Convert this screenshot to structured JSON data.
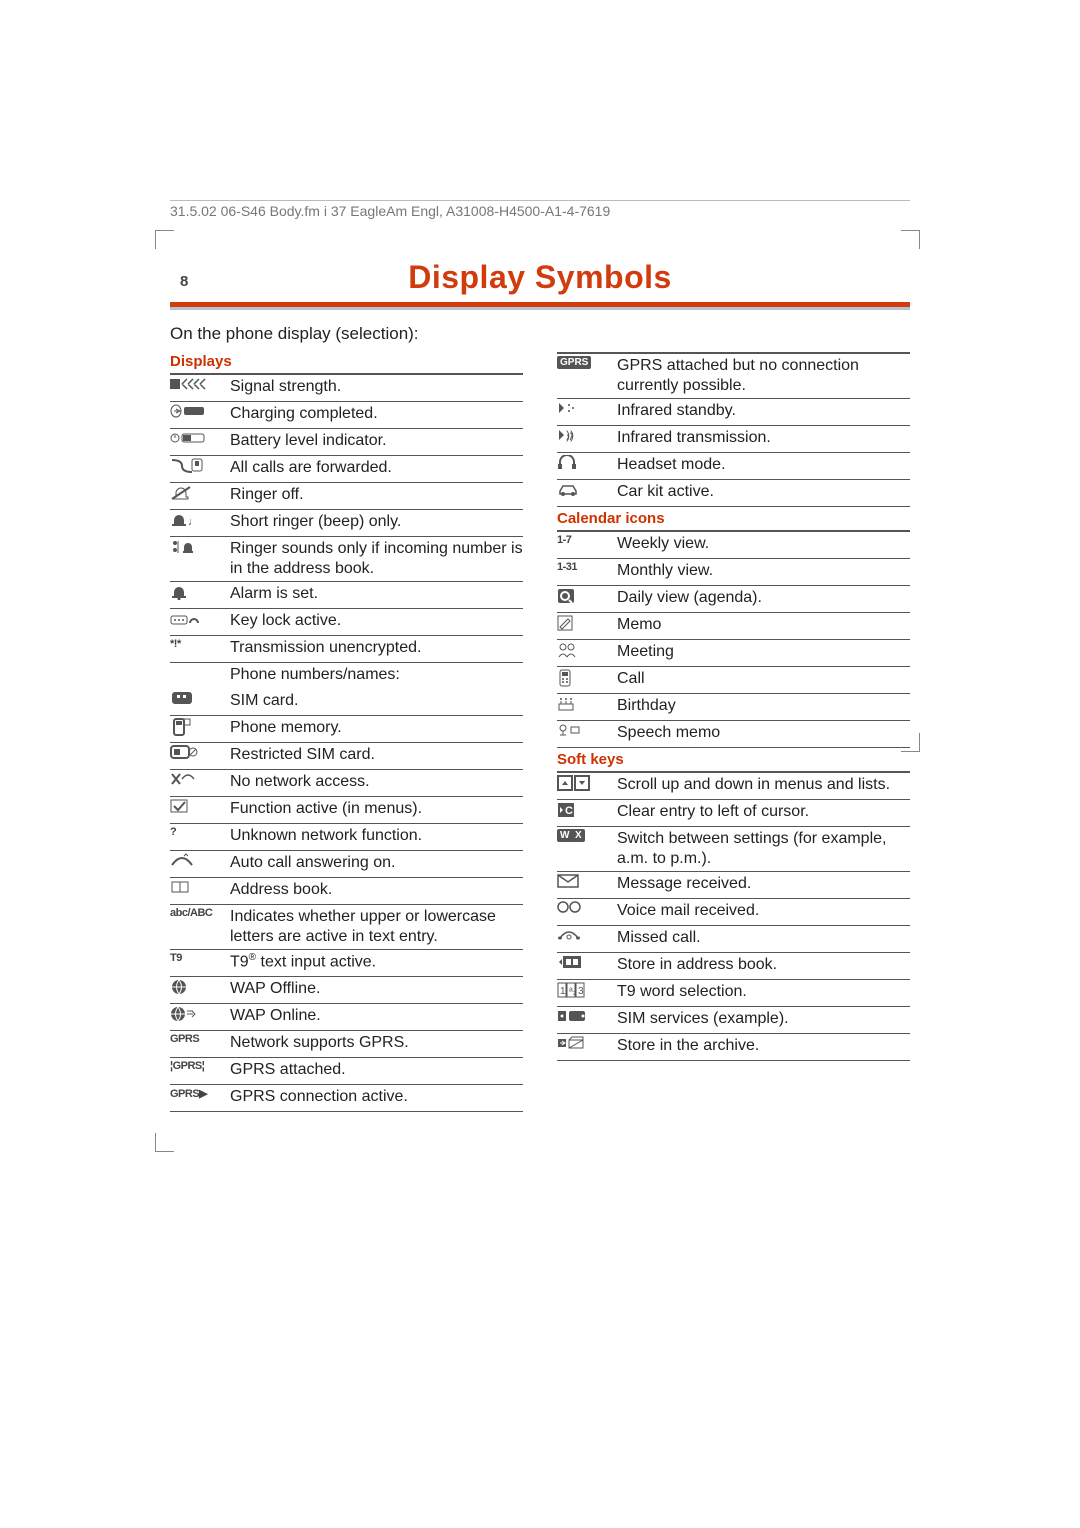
{
  "header": "31.5.02   06-S46 Body.fm   i 37 EagleAm Engl, A31008-H4500-A1-4-7619",
  "page_number": "8",
  "title": "Display Symbols",
  "intro": "On the phone display (selection):",
  "sections": {
    "displays": {
      "heading": "Displays",
      "rows": [
        {
          "icon": "signal",
          "text": "Signal strength."
        },
        {
          "icon": "charge-done",
          "text": "Charging completed."
        },
        {
          "icon": "battery",
          "text": "Battery level indicator."
        },
        {
          "icon": "forward",
          "text": "All calls are forwarded."
        },
        {
          "icon": "ringer-off",
          "text": "Ringer off."
        },
        {
          "icon": "beep",
          "text": "Short ringer (beep) only."
        },
        {
          "icon": "addr-ring",
          "text": "Ringer sounds only if incoming number is in the address book."
        },
        {
          "icon": "alarm",
          "text": "Alarm is set."
        },
        {
          "icon": "keylock",
          "text": "Key lock active."
        },
        {
          "icon": "unenc",
          "label": "*!*",
          "text": "Transmission unencrypted."
        },
        {
          "icon": "",
          "text": "Phone numbers/names:",
          "noborder": true
        },
        {
          "icon": "sim",
          "text": "SIM card."
        },
        {
          "icon": "phone-mem",
          "text": "Phone memory."
        },
        {
          "icon": "sim-restr",
          "text": "Restricted SIM card."
        },
        {
          "icon": "no-net",
          "text": "No network access."
        },
        {
          "icon": "func-active",
          "text": "Function active (in menus)."
        },
        {
          "icon": "question",
          "label": "?",
          "text": "Unknown network function."
        },
        {
          "icon": "auto-ans",
          "text": "Auto call answering on."
        },
        {
          "icon": "book",
          "text": "Address book."
        },
        {
          "icon": "abc",
          "label": "abc/ABC",
          "text": "Indicates whether upper or lowercase letters are active in text entry."
        },
        {
          "icon": "t9",
          "label": "T9",
          "text_html": "T9<span class='sup'>®</span> text input active."
        },
        {
          "icon": "wap-off",
          "text": "WAP Offline."
        },
        {
          "icon": "wap-on",
          "text": "WAP Online."
        },
        {
          "icon": "gprs",
          "label": "GPRS",
          "text": "Network supports GPRS."
        },
        {
          "icon": "gprs-att",
          "label": "¦GPRS¦",
          "text": "GPRS attached."
        },
        {
          "icon": "gprs-act",
          "label": "GPRS▶",
          "text": "GPRS connection active."
        }
      ]
    },
    "right_top": {
      "rows": [
        {
          "icon": "gprs-badge",
          "label": "GPRS",
          "text": "GPRS attached but no connection currently possible."
        },
        {
          "icon": "ir-standby",
          "text": "Infrared standby."
        },
        {
          "icon": "ir-tx",
          "text": "Infrared transmission."
        },
        {
          "icon": "headset",
          "text": "Headset mode."
        },
        {
          "icon": "carkit",
          "text": "Car kit active."
        }
      ]
    },
    "calendar": {
      "heading": "Calendar icons",
      "rows": [
        {
          "icon": "text",
          "label": "1-7",
          "text": "Weekly view."
        },
        {
          "icon": "text",
          "label": "1-31",
          "text": "Monthly view."
        },
        {
          "icon": "agenda",
          "text": "Daily view (agenda)."
        },
        {
          "icon": "memo",
          "text": "Memo"
        },
        {
          "icon": "meeting",
          "text": "Meeting"
        },
        {
          "icon": "call-cal",
          "text": "Call"
        },
        {
          "icon": "birthday",
          "text": "Birthday"
        },
        {
          "icon": "speech",
          "text": "Speech memo"
        }
      ]
    },
    "softkeys": {
      "heading": "Soft keys",
      "rows": [
        {
          "icon": "scroll",
          "text": "Scroll up and down in menus and lists."
        },
        {
          "icon": "clear",
          "text": "Clear entry to left of cursor."
        },
        {
          "icon": "wx",
          "label": "W  X",
          "text": "Switch between settings (for example, a.m. to p.m.)."
        },
        {
          "icon": "msg",
          "text": "Message received."
        },
        {
          "icon": "vmail",
          "text": "Voice mail received."
        },
        {
          "icon": "missed",
          "text": "Missed call."
        },
        {
          "icon": "store-ab",
          "text": "Store in address book."
        },
        {
          "icon": "t9sel",
          "text": "T9 word selection."
        },
        {
          "icon": "sim-svc",
          "text": "SIM services (example)."
        },
        {
          "icon": "archive",
          "text": "Store in the archive."
        }
      ]
    }
  }
}
